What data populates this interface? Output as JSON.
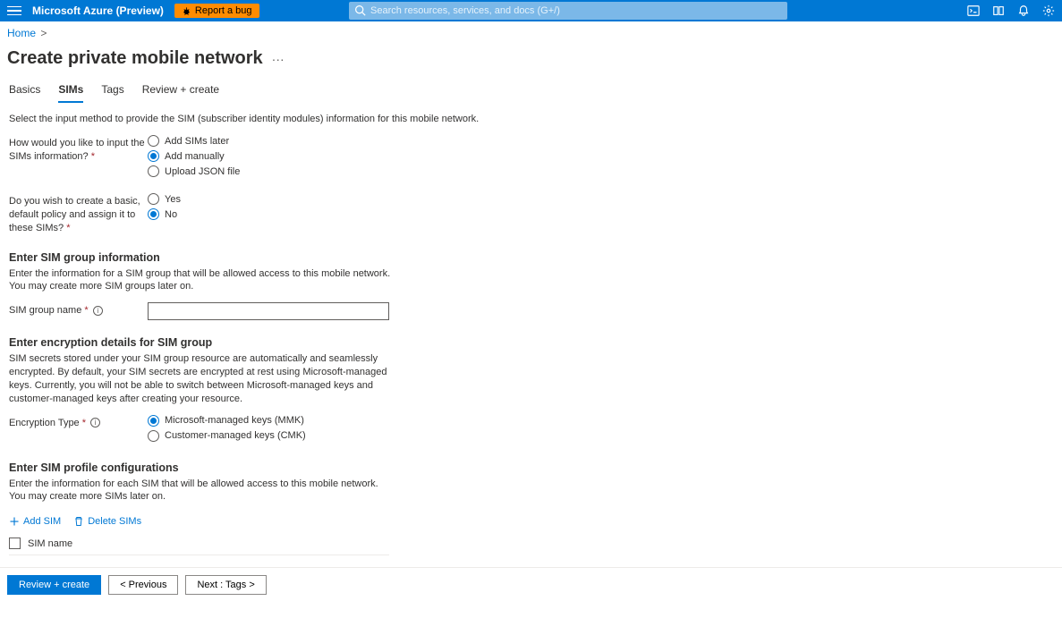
{
  "header": {
    "brand": "Microsoft Azure (Preview)",
    "bug_label": "Report a bug",
    "search_placeholder": "Search resources, services, and docs (G+/)"
  },
  "breadcrumb": {
    "items": [
      "Home"
    ],
    "sep": ">"
  },
  "title": "Create private mobile network",
  "tabs": [
    {
      "label": "Basics",
      "active": false
    },
    {
      "label": "SIMs",
      "active": true
    },
    {
      "label": "Tags",
      "active": false
    },
    {
      "label": "Review + create",
      "active": false
    }
  ],
  "intro": "Select the input method to provide the SIM (subscriber identity modules) information for this mobile network.",
  "input_method": {
    "label": "How would you like to input the SIMs information?",
    "options": [
      "Add SIMs later",
      "Add manually",
      "Upload JSON file"
    ],
    "selected": "Add manually"
  },
  "default_policy": {
    "label": "Do you wish to create a basic, default policy and assign it to these SIMs?",
    "options": [
      "Yes",
      "No"
    ],
    "selected": "No"
  },
  "sim_group": {
    "heading": "Enter SIM group information",
    "desc": "Enter the information for a SIM group that will be allowed access to this mobile network. You may create more SIM groups later on.",
    "name_label": "SIM group name",
    "name_value": ""
  },
  "encryption": {
    "heading": "Enter encryption details for SIM group",
    "desc": "SIM secrets stored under your SIM group resource are automatically and seamlessly encrypted. By default, your SIM secrets are encrypted at rest using Microsoft-managed keys. Currently, you will not be able to switch between Microsoft-managed keys and customer-managed keys after creating your resource.",
    "type_label": "Encryption Type",
    "options": [
      "Microsoft-managed keys (MMK)",
      "Customer-managed keys (CMK)"
    ],
    "selected": "Microsoft-managed keys (MMK)"
  },
  "profile": {
    "heading": "Enter SIM profile configurations",
    "desc": "Enter the information for each SIM that will be allowed access to this mobile network. You may create more SIMs later on.",
    "add_label": "Add SIM",
    "delete_label": "Delete SIMs",
    "column": "SIM name"
  },
  "footer": {
    "review": "Review + create",
    "previous": "< Previous",
    "next": "Next : Tags >"
  }
}
